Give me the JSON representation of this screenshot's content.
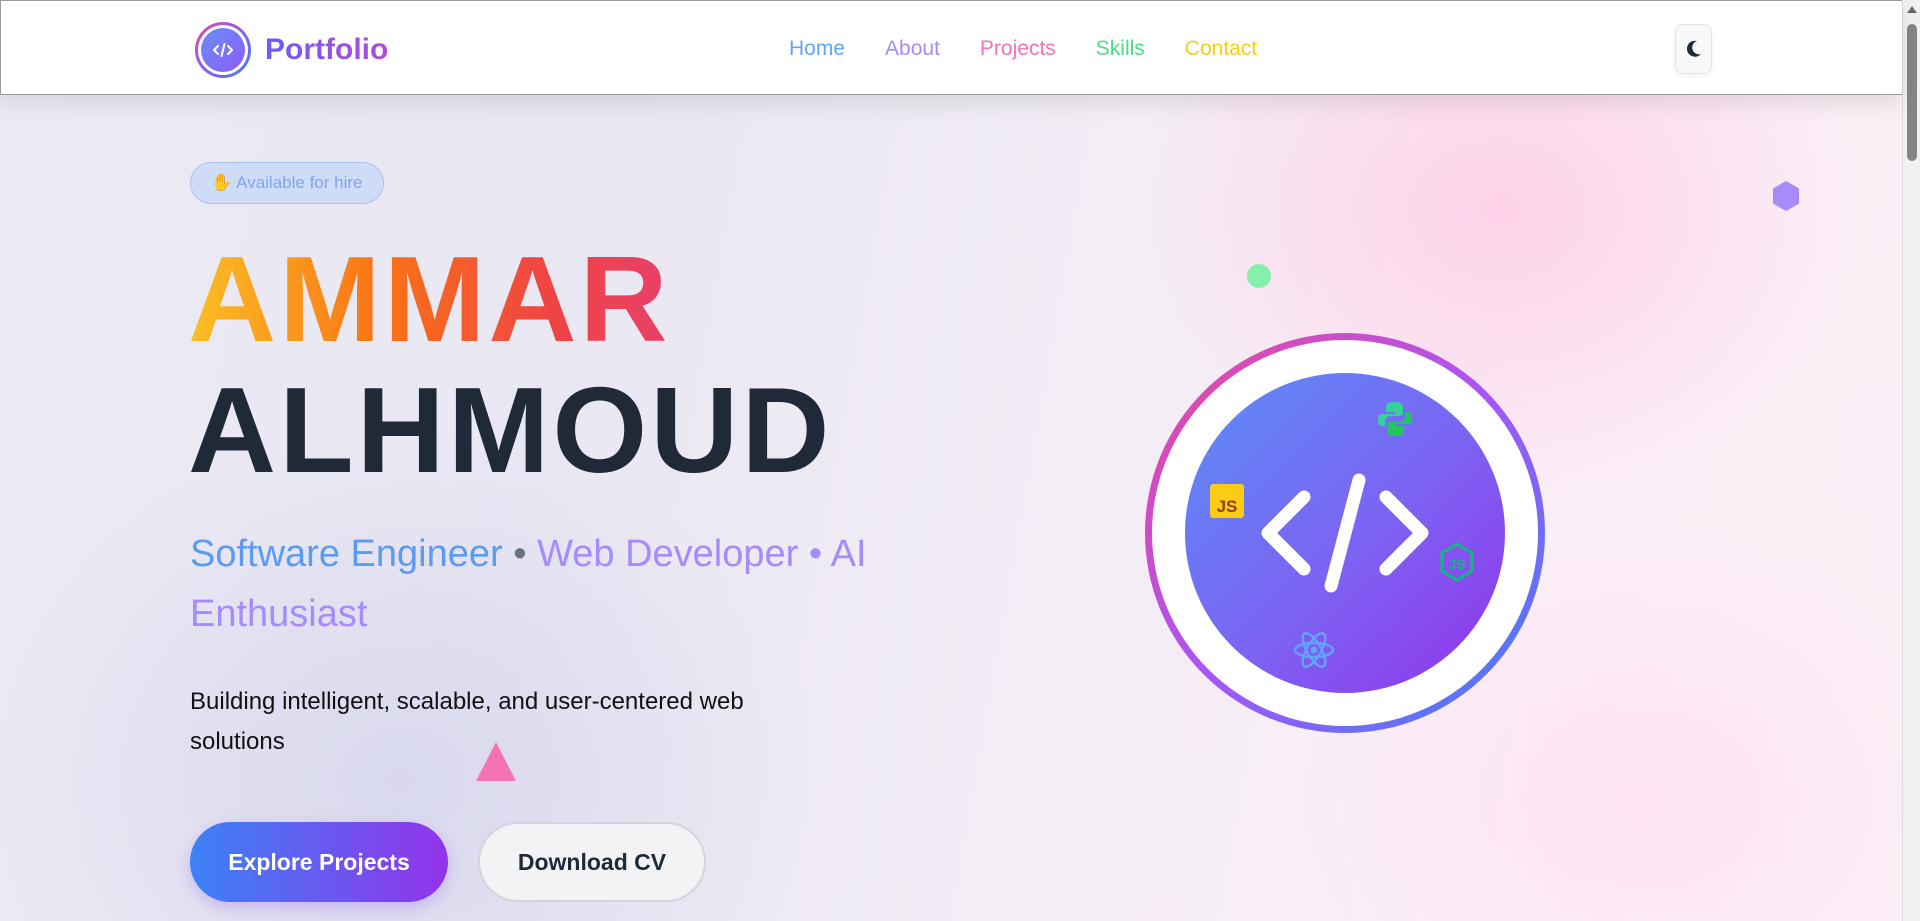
{
  "navbar": {
    "brand": "Portfolio",
    "brand_logo_icon": "code-icon",
    "links": [
      {
        "label": "Home",
        "color": "#60a5fa"
      },
      {
        "label": "About",
        "color": "#a78bfa"
      },
      {
        "label": "Projects",
        "color": "#f472b6"
      },
      {
        "label": "Skills",
        "color": "#4ade80"
      },
      {
        "label": "Contact",
        "color": "#facc15"
      }
    ],
    "theme_toggle_icon": "moon-icon"
  },
  "hero": {
    "badge_icon": "waving-hand-icon",
    "badge": "Available for hire",
    "first_name": "AMMAR",
    "last_name": "ALHMOUD",
    "roles": {
      "role1": "Software Engineer",
      "separator": "•",
      "role2": "Web Developer",
      "separator2": "•",
      "role3": "AI Enthusiast"
    },
    "tagline": "Building intelligent, scalable, and user-centered web solutions",
    "primary_button": "Explore Projects",
    "secondary_button": "Download CV"
  },
  "graphic": {
    "center_icon": "code-icon",
    "tech_icons": [
      "python-icon",
      "javascript-icon",
      "nodejs-icon",
      "react-icon"
    ],
    "js_badge": "JS"
  },
  "colors": {
    "gradient_start": "#3b82f6",
    "gradient_end": "#9333ea",
    "dark_text": "#1f2937"
  }
}
